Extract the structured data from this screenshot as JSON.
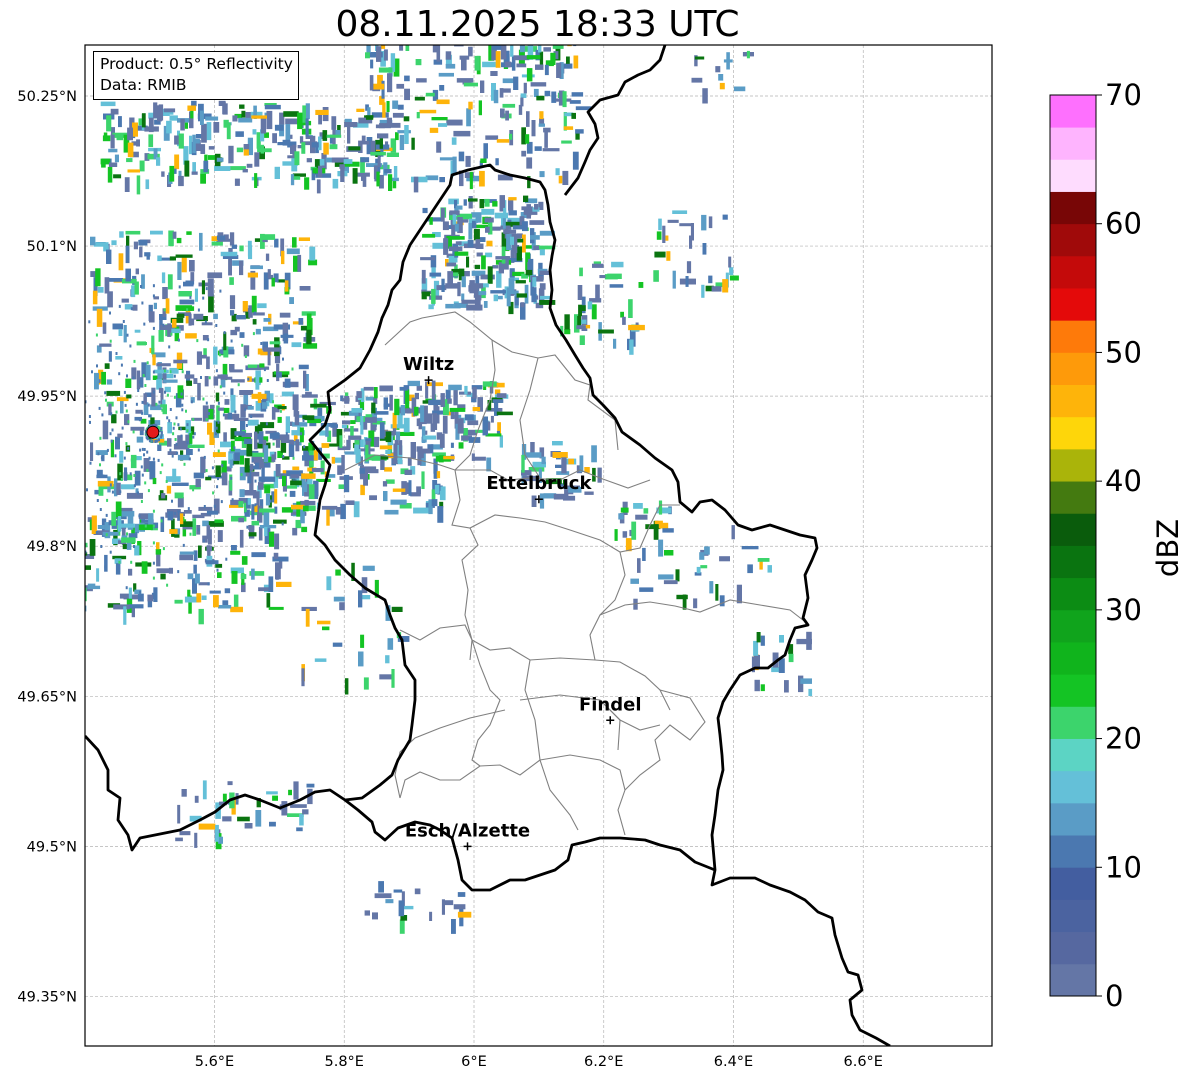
{
  "title": "08.11.2025 18:33 UTC",
  "info": {
    "product_line": "Product: 0.5° Reflectivity",
    "data_line": "Data: RMIB"
  },
  "map": {
    "type": "radar-reflectivity-map",
    "lon_range": [
      5.4,
      6.8
    ],
    "lat_range": [
      49.27,
      50.27
    ],
    "grid": true,
    "x_ticks": [
      {
        "value": 5.6,
        "label": "5.6°E"
      },
      {
        "value": 5.8,
        "label": "5.8°E"
      },
      {
        "value": 6.0,
        "label": "6°E"
      },
      {
        "value": 6.2,
        "label": "6.2°E"
      },
      {
        "value": 6.4,
        "label": "6.4°E"
      },
      {
        "value": 6.6,
        "label": "6.6°E"
      }
    ],
    "y_ticks": [
      {
        "value": 50.25,
        "label": "50.25°N"
      },
      {
        "value": 50.1,
        "label": "50.1°N"
      },
      {
        "value": 49.95,
        "label": "49.95°N"
      },
      {
        "value": 49.8,
        "label": "49.8°N"
      },
      {
        "value": 49.65,
        "label": "49.65°N"
      },
      {
        "value": 49.5,
        "label": "49.5°N"
      },
      {
        "value": 49.35,
        "label": "49.35°N"
      }
    ],
    "cities": [
      {
        "name": "Wiltz",
        "lon": 5.93,
        "lat": 49.966
      },
      {
        "name": "Ettelbruck",
        "lon": 6.1,
        "lat": 49.847
      },
      {
        "name": "Findel",
        "lon": 6.21,
        "lat": 49.626
      },
      {
        "name": "Esch/Alzette",
        "lon": 5.99,
        "lat": 49.5
      }
    ],
    "radar_site": {
      "lon": 5.505,
      "lat": 49.914
    }
  },
  "colorbar": {
    "label": "dBZ",
    "min": 0,
    "max": 70,
    "ticks": [
      0,
      10,
      20,
      30,
      40,
      50,
      60,
      70
    ],
    "step": 2.5,
    "colors": [
      "#6476a6",
      "#5668a0",
      "#4b63a0",
      "#435ea0",
      "#4b78b0",
      "#5a9cc6",
      "#64c0d8",
      "#5cd4c4",
      "#3cd46c",
      "#14c424",
      "#10b41c",
      "#10a41c",
      "#0c8c14",
      "#0a7410",
      "#0a5c0c",
      "#447a10",
      "#aab40a",
      "#fed60a",
      "#feb40a",
      "#fe9a0a",
      "#fe7a0a",
      "#e40a0a",
      "#c40a0a",
      "#a00a0a",
      "#780606",
      "#fedcfe",
      "#feb4fe",
      "#fe70fe",
      "#ec3cec"
    ]
  },
  "echo_colors": [
    "#6476a6",
    "#4b78b0",
    "#5a9cc6",
    "#64c0d8",
    "#3cd46c",
    "#14c424",
    "#0a7410",
    "#feb40a"
  ]
}
